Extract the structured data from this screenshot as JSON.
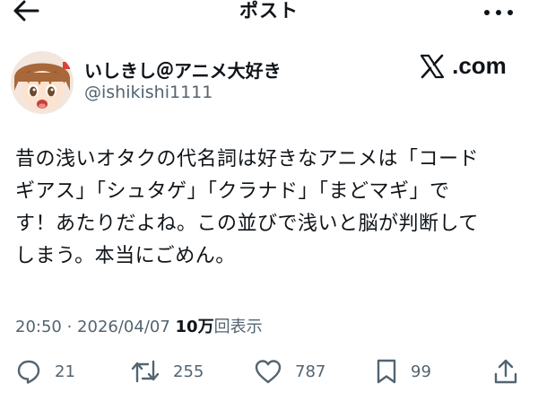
{
  "header": {
    "title": "ポスト"
  },
  "author": {
    "display_name": "いしきし＠アニメ大好き",
    "handle": "@ishikishi1111"
  },
  "source_badge": ".com",
  "tweet": {
    "lines": [
      "昔の浅いオタクの代名詞は好きなアニメは「コード",
      "ギアス」「シュタゲ」「クラナド」「まどマギ」で",
      "す！あたりだよね。この並びで浅いと脳が判断して",
      "しまう。本当にごめん。"
    ]
  },
  "meta": {
    "time": "20:50",
    "separator": " · ",
    "date": "2026/04/07",
    "views_count": "10万",
    "views_label": "回表示"
  },
  "actions": {
    "replies": "21",
    "reposts": "255",
    "likes": "787",
    "bookmarks": "99"
  },
  "colors": {
    "text": "#0f1419",
    "secondary": "#536471",
    "background": "#ffffff"
  },
  "icons": [
    "back-arrow-icon",
    "more-dots-icon",
    "x-logo-icon",
    "reply-icon",
    "repost-icon",
    "like-icon",
    "bookmark-icon",
    "share-icon"
  ]
}
